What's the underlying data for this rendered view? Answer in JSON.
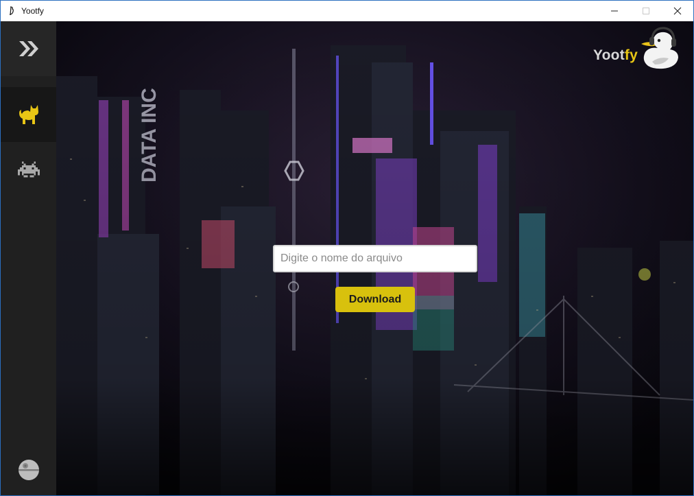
{
  "window": {
    "title": "Yootfy",
    "controls": [
      "minimize",
      "maximize",
      "close"
    ]
  },
  "sidebar": {
    "items": [
      {
        "name": "expand-toggle",
        "icon": "double-chevron-right-icon"
      },
      {
        "name": "cat",
        "icon": "cat-icon",
        "active": true
      },
      {
        "name": "invader",
        "icon": "space-invader-icon"
      },
      {
        "name": "death-star",
        "icon": "death-star-icon"
      }
    ]
  },
  "brand": {
    "name_part1": "Yoot",
    "name_part2": "fy",
    "logo": "duck-headphones-icon"
  },
  "form": {
    "input_value": "",
    "input_placeholder": "Digite o nome do arquivo",
    "button_label": "Download"
  },
  "colors": {
    "accent": "#d8c10d",
    "sidebar_bg": "#202020",
    "sidebar_active_bg": "#171717"
  }
}
